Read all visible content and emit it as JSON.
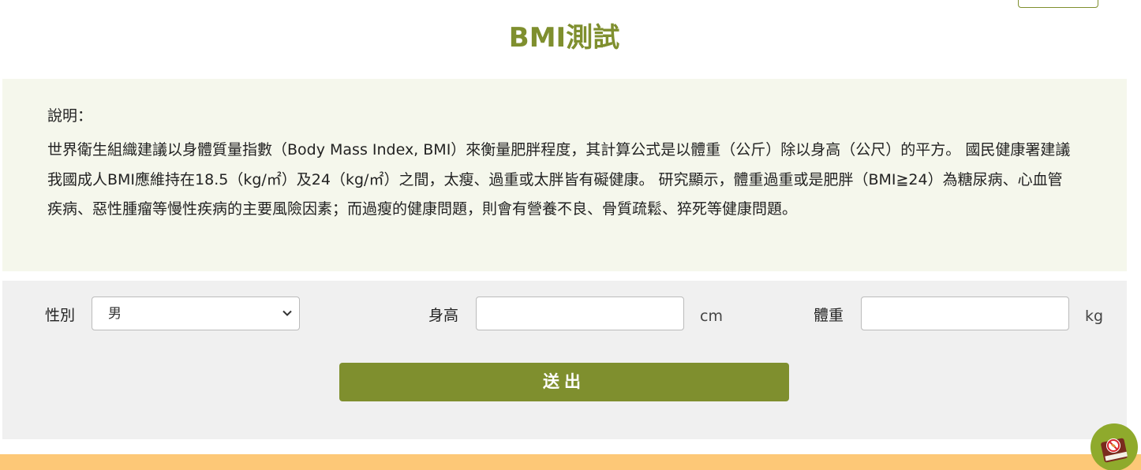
{
  "page": {
    "title": "BMI測試"
  },
  "description": {
    "label": "說明：",
    "text": "世界衛生組織建議以身體質量指數（Body Mass Index, BMI）來衡量肥胖程度，其計算公式是以體重（公斤）除以身高（公尺）的平方。 國民健康署建議我國成人BMI應維持在18.5（kg/㎡）及24（kg/㎡）之間，太瘦、過重或太胖皆有礙健康。 研究顯示，體重過重或是肥胖（BMI≧24）為糖尿病、心血管疾病、惡性腫瘤等慢性疾病的主要風險因素；而過瘦的健康問題，則會有營養不良、骨質疏鬆、猝死等健康問題。"
  },
  "form": {
    "gender_label": "性別",
    "gender_selected": "男",
    "height_label": "身高",
    "height_value": "",
    "height_unit": "cm",
    "weight_label": "體重",
    "weight_value": "",
    "weight_unit": "kg",
    "submit_label": "送出"
  },
  "icons": {
    "floating": "book-badge-icon",
    "select_arrow": "chevron-down-icon"
  },
  "colors": {
    "accent": "#7f8f2e",
    "description_bg": "#f5f7ec",
    "form_bg": "#f0f0f0",
    "footer_bar": "#fdc877"
  }
}
